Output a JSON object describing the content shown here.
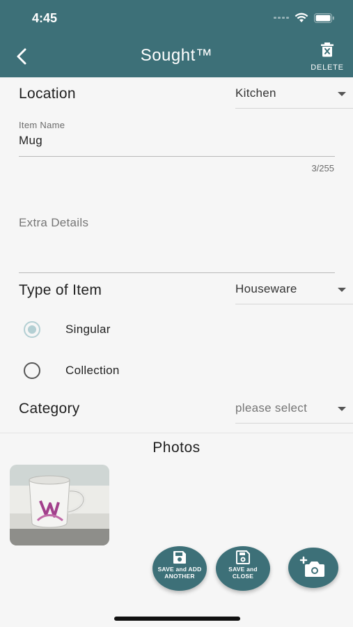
{
  "status_bar": {
    "time": "4:45"
  },
  "header": {
    "title": "Sought™",
    "delete_label": "DELETE"
  },
  "location": {
    "label": "Location",
    "value": "Kitchen"
  },
  "item_name": {
    "label": "Item Name",
    "value": "Mug",
    "counter": "3/255"
  },
  "extra_details": {
    "placeholder": "Extra Details"
  },
  "type_of_item": {
    "label": "Type of Item",
    "value": "Houseware",
    "options": [
      {
        "label": "Singular",
        "selected": true
      },
      {
        "label": "Collection",
        "selected": false
      }
    ]
  },
  "category": {
    "label": "Category",
    "value": "please select"
  },
  "photos": {
    "title": "Photos"
  },
  "actions": {
    "save_add_another": "SAVE and ADD ANOTHER",
    "save_and_close": "SAVE and CLOSE"
  },
  "colors": {
    "primary": "#3d7078",
    "radio_selected": "#b3cfd3",
    "background": "#f6f6f6"
  }
}
